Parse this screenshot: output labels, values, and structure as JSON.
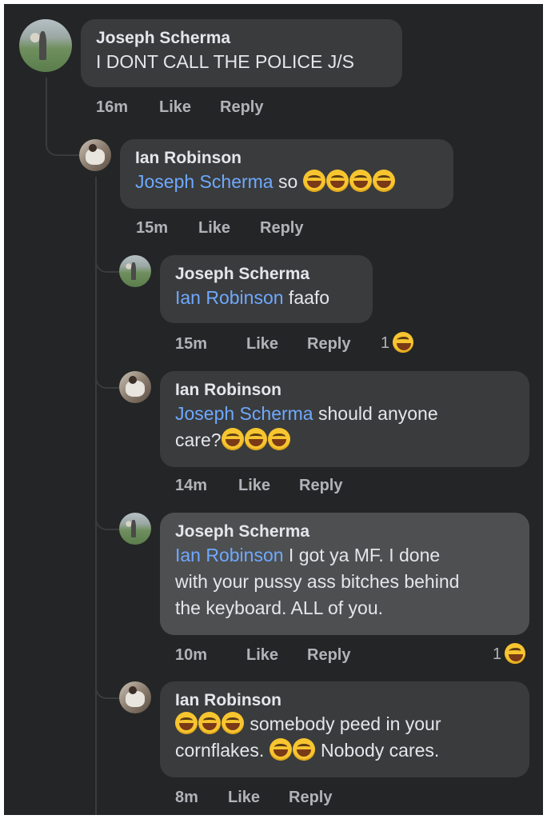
{
  "comments": [
    {
      "author": "Joseph Scherma",
      "mention": "",
      "text": "I DONT CALL THE POLICE  J/S",
      "emoji_count": 0,
      "time": "16m",
      "like": "Like",
      "reply": "Reply",
      "reaction_count": ""
    },
    {
      "author": "Ian Robinson",
      "mention": "Joseph Scherma",
      "text": " so ",
      "emoji_count": 4,
      "time": "15m",
      "like": "Like",
      "reply": "Reply",
      "reaction_count": ""
    },
    {
      "author": "Joseph Scherma",
      "mention": "Ian Robinson",
      "text": " faafo",
      "emoji_count": 0,
      "time": "15m",
      "like": "Like",
      "reply": "Reply",
      "reaction_count": "1"
    },
    {
      "author": "Ian Robinson",
      "mention": "Joseph Scherma",
      "text": " should anyone",
      "text2": "care?",
      "emoji_count": 3,
      "time": "14m",
      "like": "Like",
      "reply": "Reply",
      "reaction_count": ""
    },
    {
      "author": "Joseph Scherma",
      "mention": "Ian Robinson",
      "text": " I got ya MF. I done",
      "text2": "with your pussy ass bitches behind",
      "text3": "the keyboard. ALL of you.",
      "time": "10m",
      "like": "Like",
      "reply": "Reply",
      "reaction_count": "1"
    },
    {
      "author": "Ian Robinson",
      "text": " somebody peed in your",
      "text2": "cornflakes. ",
      "text3": " Nobody cares.",
      "time": "8m",
      "like": "Like",
      "reply": "Reply",
      "reaction_count": ""
    }
  ],
  "emoji": {
    "laugh": "tears-of-joy-emoji",
    "react": "laughing-squint-emoji"
  },
  "colors": {
    "background": "#242526",
    "bubble": "#3a3b3c",
    "bubble_highlight": "#4e4f50",
    "mention": "#6ea9ff",
    "text": "#e4e6eb",
    "meta": "#b0b3b8"
  }
}
